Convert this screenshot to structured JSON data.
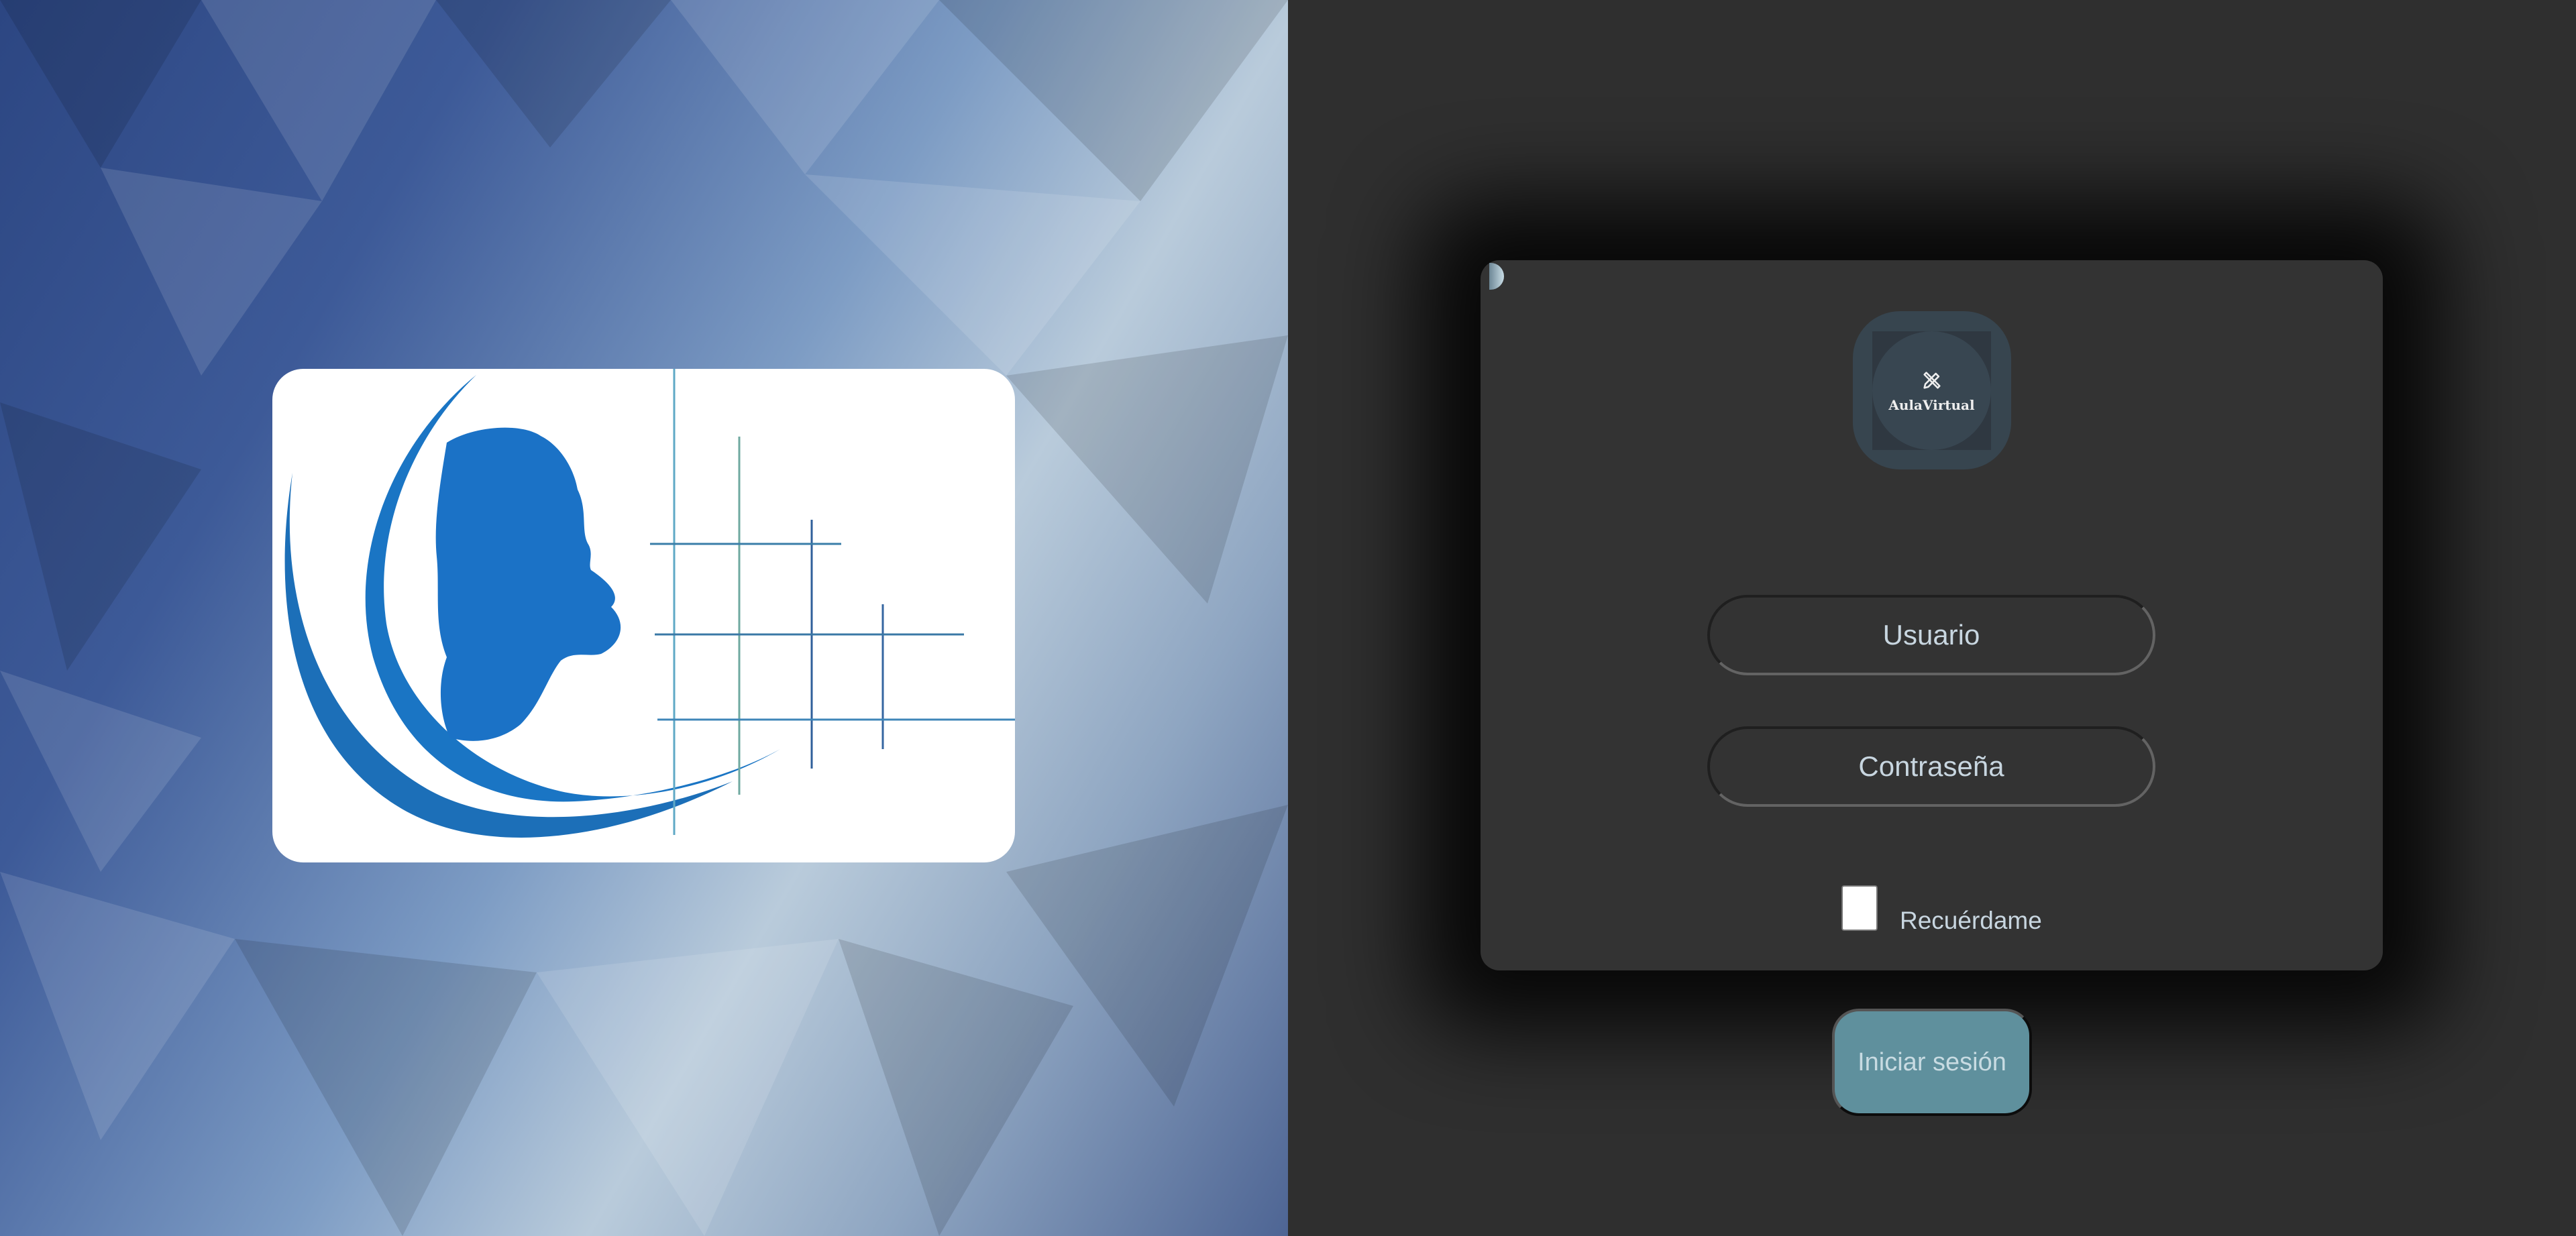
{
  "brand": {
    "name": "AulaVirtual",
    "icon": "pencil-ruler-icon"
  },
  "login": {
    "username_placeholder": "Usuario",
    "password_placeholder": "Contraseña",
    "remember_label": "Recuérdame",
    "remember_checked": false,
    "submit_label": "Iniciar sesión"
  },
  "colors": {
    "button": "#5f909d",
    "card": "#333333",
    "logo_blue": "#1a75c4"
  }
}
